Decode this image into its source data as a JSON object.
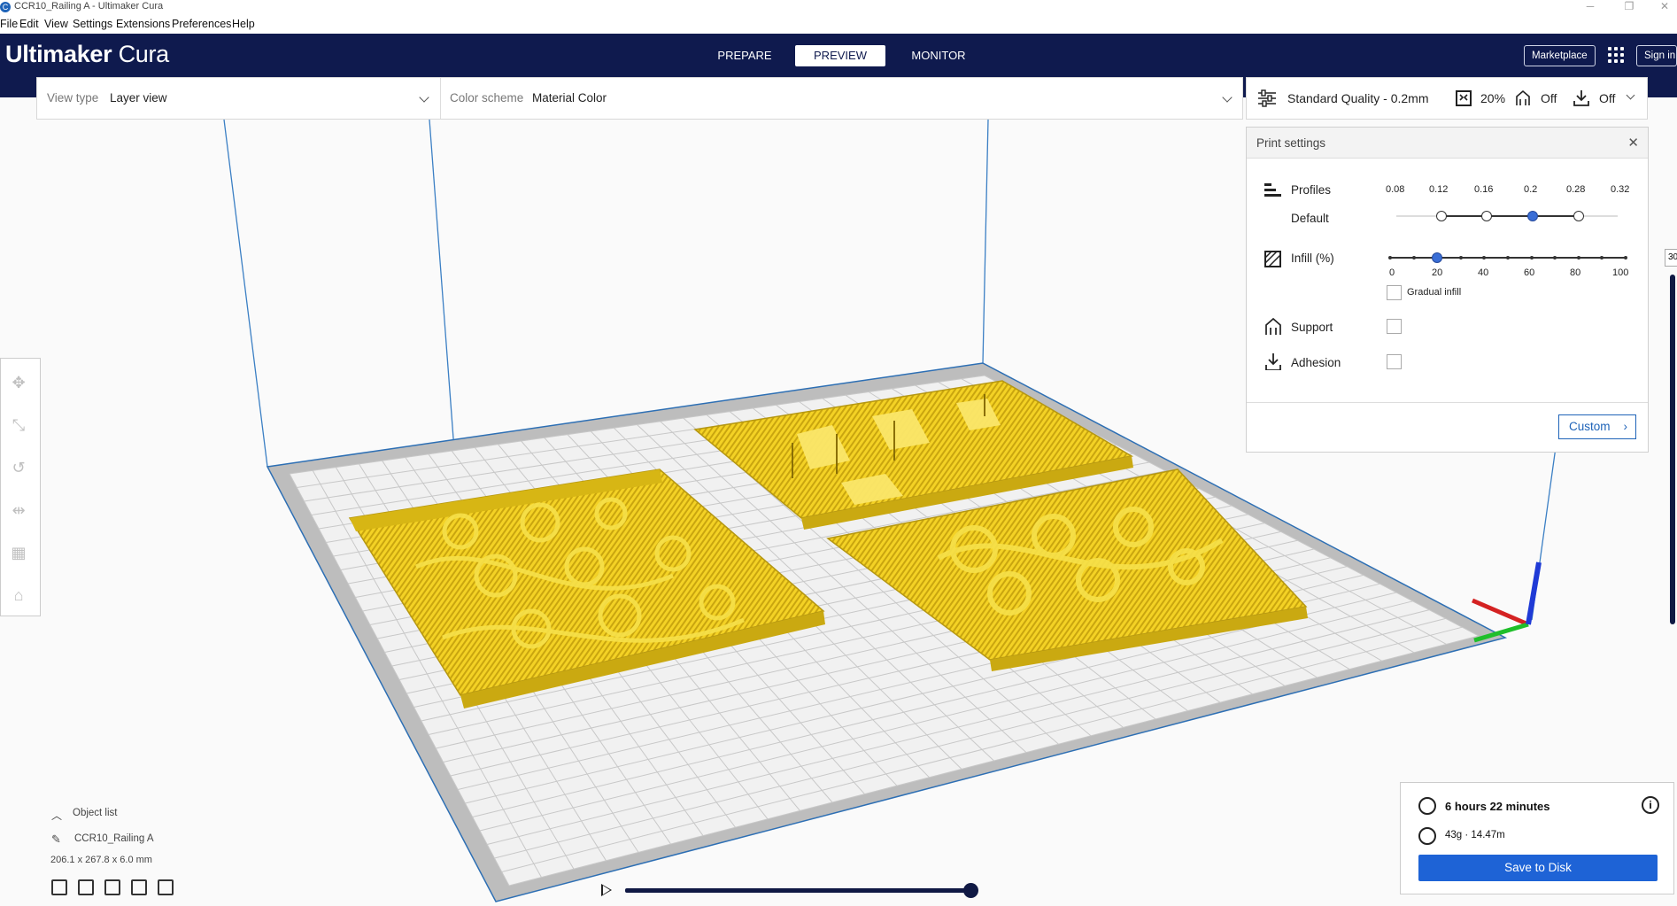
{
  "window": {
    "title": "CCR10_Railing A - Ultimaker Cura",
    "app_icon_letter": "C"
  },
  "menu": [
    "File",
    "Edit",
    "View",
    "Settings",
    "Extensions",
    "Preferences",
    "Help"
  ],
  "header": {
    "logo_bold": "Ultimaker",
    "logo_light": "Cura",
    "tabs": [
      "PREPARE",
      "PREVIEW",
      "MONITOR"
    ],
    "active_tab": "PREVIEW",
    "marketplace_label": "Marketplace",
    "signin_label": "Sign in"
  },
  "viewbar": {
    "view_type_label": "View type",
    "view_type_value": "Layer view",
    "color_scheme_label": "Color scheme",
    "color_scheme_value": "Material Color"
  },
  "print_summary": {
    "profile": "Standard Quality - 0.2mm",
    "infill": "20%",
    "support": "Off",
    "adhesion": "Off"
  },
  "print_settings": {
    "title": "Print settings",
    "profiles_label": "Profiles",
    "profile_name": "Default",
    "layer_heights": [
      "0.08",
      "0.12",
      "0.16",
      "0.2",
      "0.28",
      "0.32"
    ],
    "selected_layer_height": "0.2",
    "infill_label": "Infill (%)",
    "infill_ticks": [
      "0",
      "20",
      "40",
      "60",
      "80",
      "100"
    ],
    "infill_value": 20,
    "gradual_infill_label": "Gradual infill",
    "support_label": "Support",
    "adhesion_label": "Adhesion",
    "custom_button": "Custom"
  },
  "object_list": {
    "header": "Object list",
    "object_name": "CCR10_Railing A",
    "dimensions": "206.1 x 267.8 x 6.0 mm"
  },
  "output": {
    "print_time": "6 hours 22 minutes",
    "material": "43g · 14.47m",
    "save_button": "Save to Disk"
  },
  "layer_slider": {
    "top_layer_partial": "30"
  },
  "colors": {
    "header_bg": "#0f1a4e",
    "accent_blue": "#1e63d6",
    "filament_yellow": "#f5d327",
    "build_plate_grid": "#c8c8c8"
  }
}
